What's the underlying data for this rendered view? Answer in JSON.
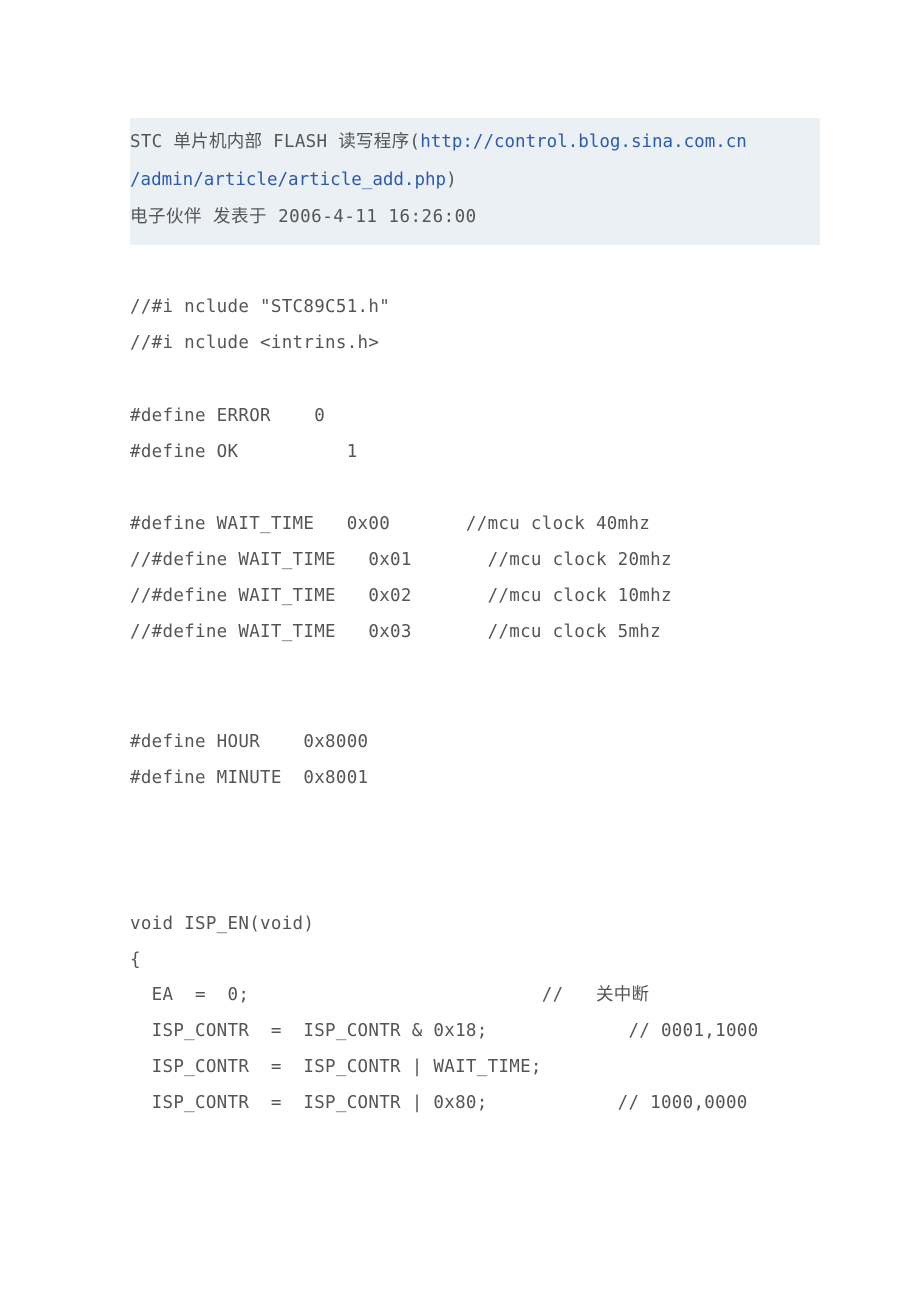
{
  "title": {
    "prefix": "STC 单片机内部 FLASH 读写程序(",
    "url_text": "http://control.blog.sina.com.cn",
    "url_text2": "/admin/article/article_add.php",
    "suffix": ")"
  },
  "meta": "电子伙伴 发表于 2006-4-11 16:26:00",
  "code": {
    "l1": "//#i nclude \"STC89C51.h\"",
    "l2": "//#i nclude <intrins.h>",
    "l3": "#define ERROR    0",
    "l4": "#define OK          1",
    "l5": "#define WAIT_TIME   0x00       //mcu clock 40mhz",
    "l6": "//#define WAIT_TIME   0x01       //mcu clock 20mhz",
    "l7": "//#define WAIT_TIME   0x02       //mcu clock 10mhz",
    "l8": "//#define WAIT_TIME   0x03       //mcu clock 5mhz",
    "l9": "#define HOUR    0x8000",
    "l10": "#define MINUTE  0x8001",
    "l11": "void ISP_EN(void)",
    "l12": "{",
    "l13": "  EA  =  0;                           //   关中断",
    "l14": "  ISP_CONTR  =  ISP_CONTR & 0x18;             // 0001,1000",
    "l15": "  ISP_CONTR  =  ISP_CONTR | WAIT_TIME;",
    "l16": "  ISP_CONTR  =  ISP_CONTR | 0x80;            // 1000,0000"
  }
}
